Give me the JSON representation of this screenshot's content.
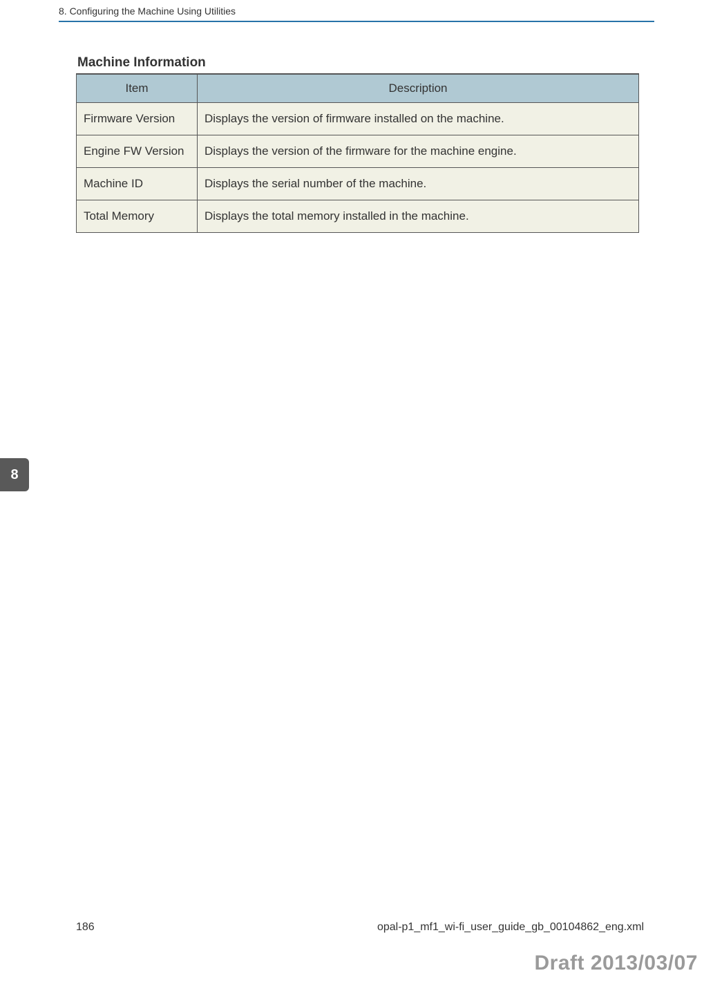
{
  "header": {
    "running_title": "8. Configuring the Machine Using Utilities"
  },
  "section": {
    "title": "Machine Information",
    "columns": {
      "item": "Item",
      "description": "Description"
    },
    "rows": [
      {
        "item": "Firmware Version",
        "description": "Displays the version of firmware installed on the machine."
      },
      {
        "item": "Engine FW Version",
        "description": "Displays the version of the firmware for the machine engine."
      },
      {
        "item": "Machine ID",
        "description": "Displays the serial number of the machine."
      },
      {
        "item": "Total Memory",
        "description": "Displays the total memory installed in the machine."
      }
    ]
  },
  "tab": {
    "chapter_number": "8"
  },
  "footer": {
    "page_number": "186",
    "source_file": "opal-p1_mf1_wi-fi_user_guide_gb_00104862_eng.xml"
  },
  "watermark": {
    "text": "Draft 2013/03/07"
  }
}
